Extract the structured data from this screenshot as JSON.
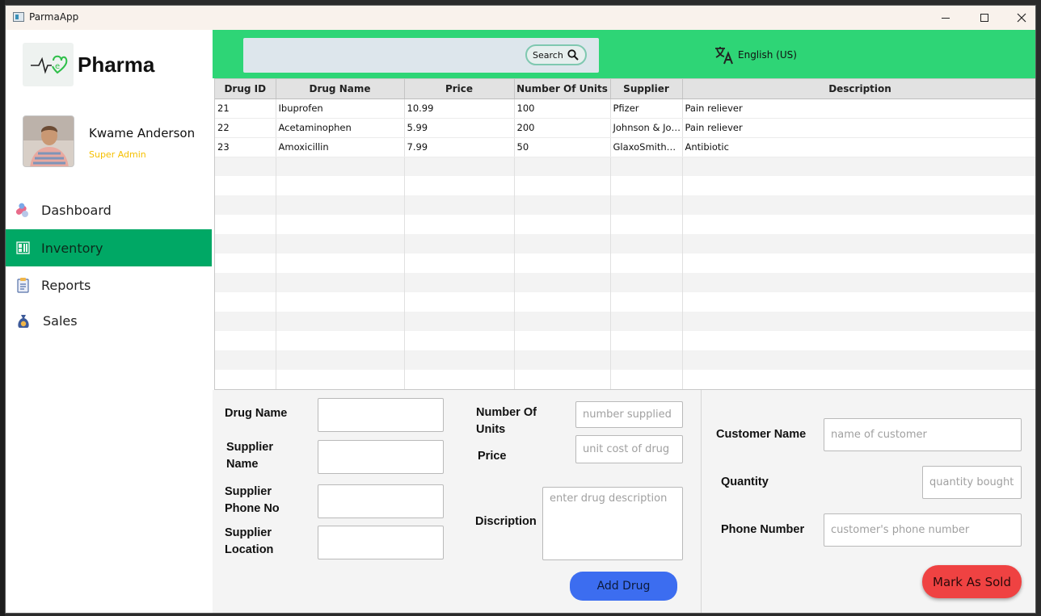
{
  "window": {
    "title": "ParmaApp"
  },
  "sidebar": {
    "brand": "Pharma",
    "user": {
      "name": "Kwame Anderson",
      "role": "Super Admin"
    },
    "nav": [
      {
        "label": "Dashboard",
        "icon": "pills-icon",
        "active": false
      },
      {
        "label": "Inventory",
        "icon": "grid-icon",
        "active": true
      },
      {
        "label": "Reports",
        "icon": "clipboard-icon",
        "active": false
      },
      {
        "label": "Sales",
        "icon": "money-bag-icon",
        "active": false
      }
    ]
  },
  "header": {
    "search": {
      "value": "",
      "button_label": "Search"
    },
    "language": "English (US)"
  },
  "table": {
    "columns": [
      "Drug ID",
      "Drug Name",
      "Price",
      "Number Of Units",
      "Supplier",
      "Description"
    ],
    "rows": [
      [
        "21",
        "Ibuprofen",
        "10.99",
        "100",
        "Pfizer",
        "Pain reliever"
      ],
      [
        "22",
        "Acetaminophen",
        "5.99",
        "200",
        "Johnson & Johnson",
        "Pain reliever"
      ],
      [
        "23",
        "Amoxicillin",
        "7.99",
        "50",
        "GlaxoSmithKline",
        "Antibiotic"
      ]
    ]
  },
  "drug_form": {
    "drug_name_label": "Drug Name",
    "supplier_name_label": "Supplier Name",
    "supplier_phone_label": "Supplier Phone No",
    "supplier_location_label": "Supplier Location",
    "units_label": "Number Of Units",
    "units_placeholder": "number supplied",
    "price_label": "Price",
    "price_placeholder": "unit cost of drug",
    "description_label": "Discription",
    "description_placeholder": "enter drug description",
    "add_button": "Add Drug"
  },
  "sale_form": {
    "customer_name_label": "Customer Name",
    "customer_name_placeholder": "name of customer",
    "quantity_label": "Quantity",
    "quantity_placeholder": "quantity bought",
    "phone_label": "Phone Number",
    "phone_placeholder": "customer's phone number",
    "sold_button": "Mark As Sold"
  },
  "colors": {
    "header_green": "#2ed576",
    "active_nav": "#00a865",
    "role_yellow": "#f5c000",
    "add_button_blue": "#3c6df0",
    "sold_button_red": "#ef4242"
  }
}
